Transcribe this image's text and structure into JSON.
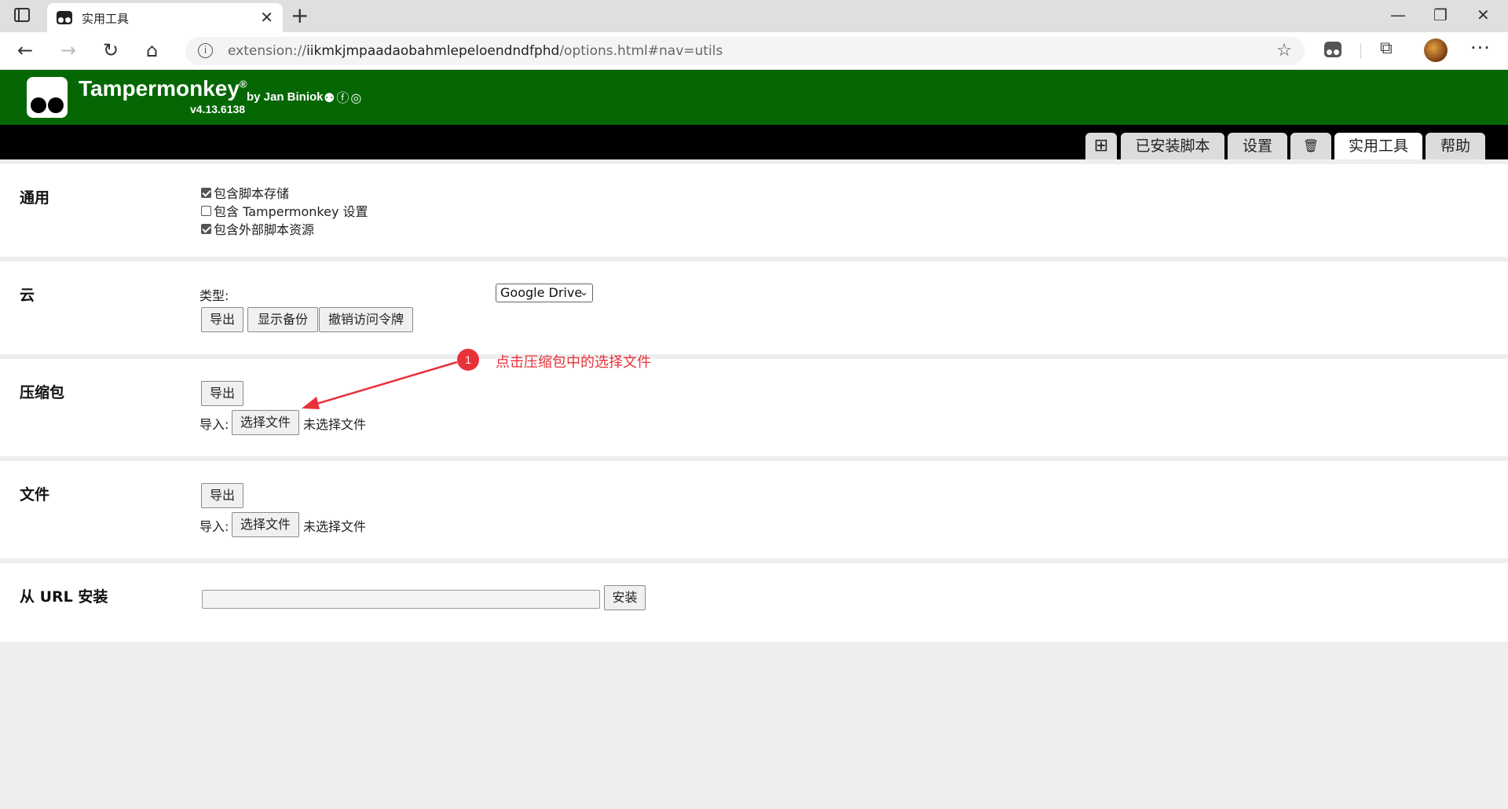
{
  "browser": {
    "tab_title": "实用工具",
    "tab_close": "✕",
    "new_tab": "+",
    "min": "—",
    "max": "❐",
    "close": "✕",
    "url_scheme": "extension://",
    "url_host": "iikmkjmpaadaobahmlepeloendndfphd",
    "url_path": "/options.html#nav=utils",
    "icons": [
      "sidebar-icon",
      "back-icon",
      "forward-icon",
      "reload-icon",
      "home-icon",
      "info-icon",
      "favorite-icon",
      "extension-icon",
      "collections-icon",
      "profile-avatar",
      "more-icon"
    ]
  },
  "header": {
    "name": "Tampermonkey",
    "reg": "®",
    "author": "by Jan Biniok",
    "version": "v4.13.6138",
    "social": "⚉ⓕ◎"
  },
  "tabs": {
    "add": "⊞",
    "installed": "已安装脚本",
    "settings": "设置",
    "trash": "🗑",
    "utils": "实用工具",
    "help": "帮助",
    "active": "utils"
  },
  "general": {
    "title": "通用",
    "options": [
      {
        "label": "包含脚本存储",
        "checked": true
      },
      {
        "label": "包含 Tampermonkey 设置",
        "checked": false
      },
      {
        "label": "包含外部脚本资源",
        "checked": true
      }
    ]
  },
  "cloud": {
    "title": "云",
    "type_label": "类型:",
    "type_value": "Google Drive",
    "export": "导出",
    "show_backup": "显示备份",
    "revoke": "撤销访问令牌"
  },
  "zip": {
    "title": "压缩包",
    "export": "导出",
    "import_label": "导入:",
    "choose_file": "选择文件",
    "no_file": "未选择文件"
  },
  "file": {
    "title": "文件",
    "export": "导出",
    "import_label": "导入:",
    "choose_file": "选择文件",
    "no_file": "未选择文件"
  },
  "url_install": {
    "title": "从 URL 安装",
    "input_value": "",
    "install": "安装"
  },
  "annotation": {
    "number": "1",
    "text": "点击压缩包中的选择文件",
    "color": "#e8323a"
  },
  "colors": {
    "header_green": "#046704",
    "tabbar_black": "#000000",
    "page_bg": "#eeeeee"
  }
}
